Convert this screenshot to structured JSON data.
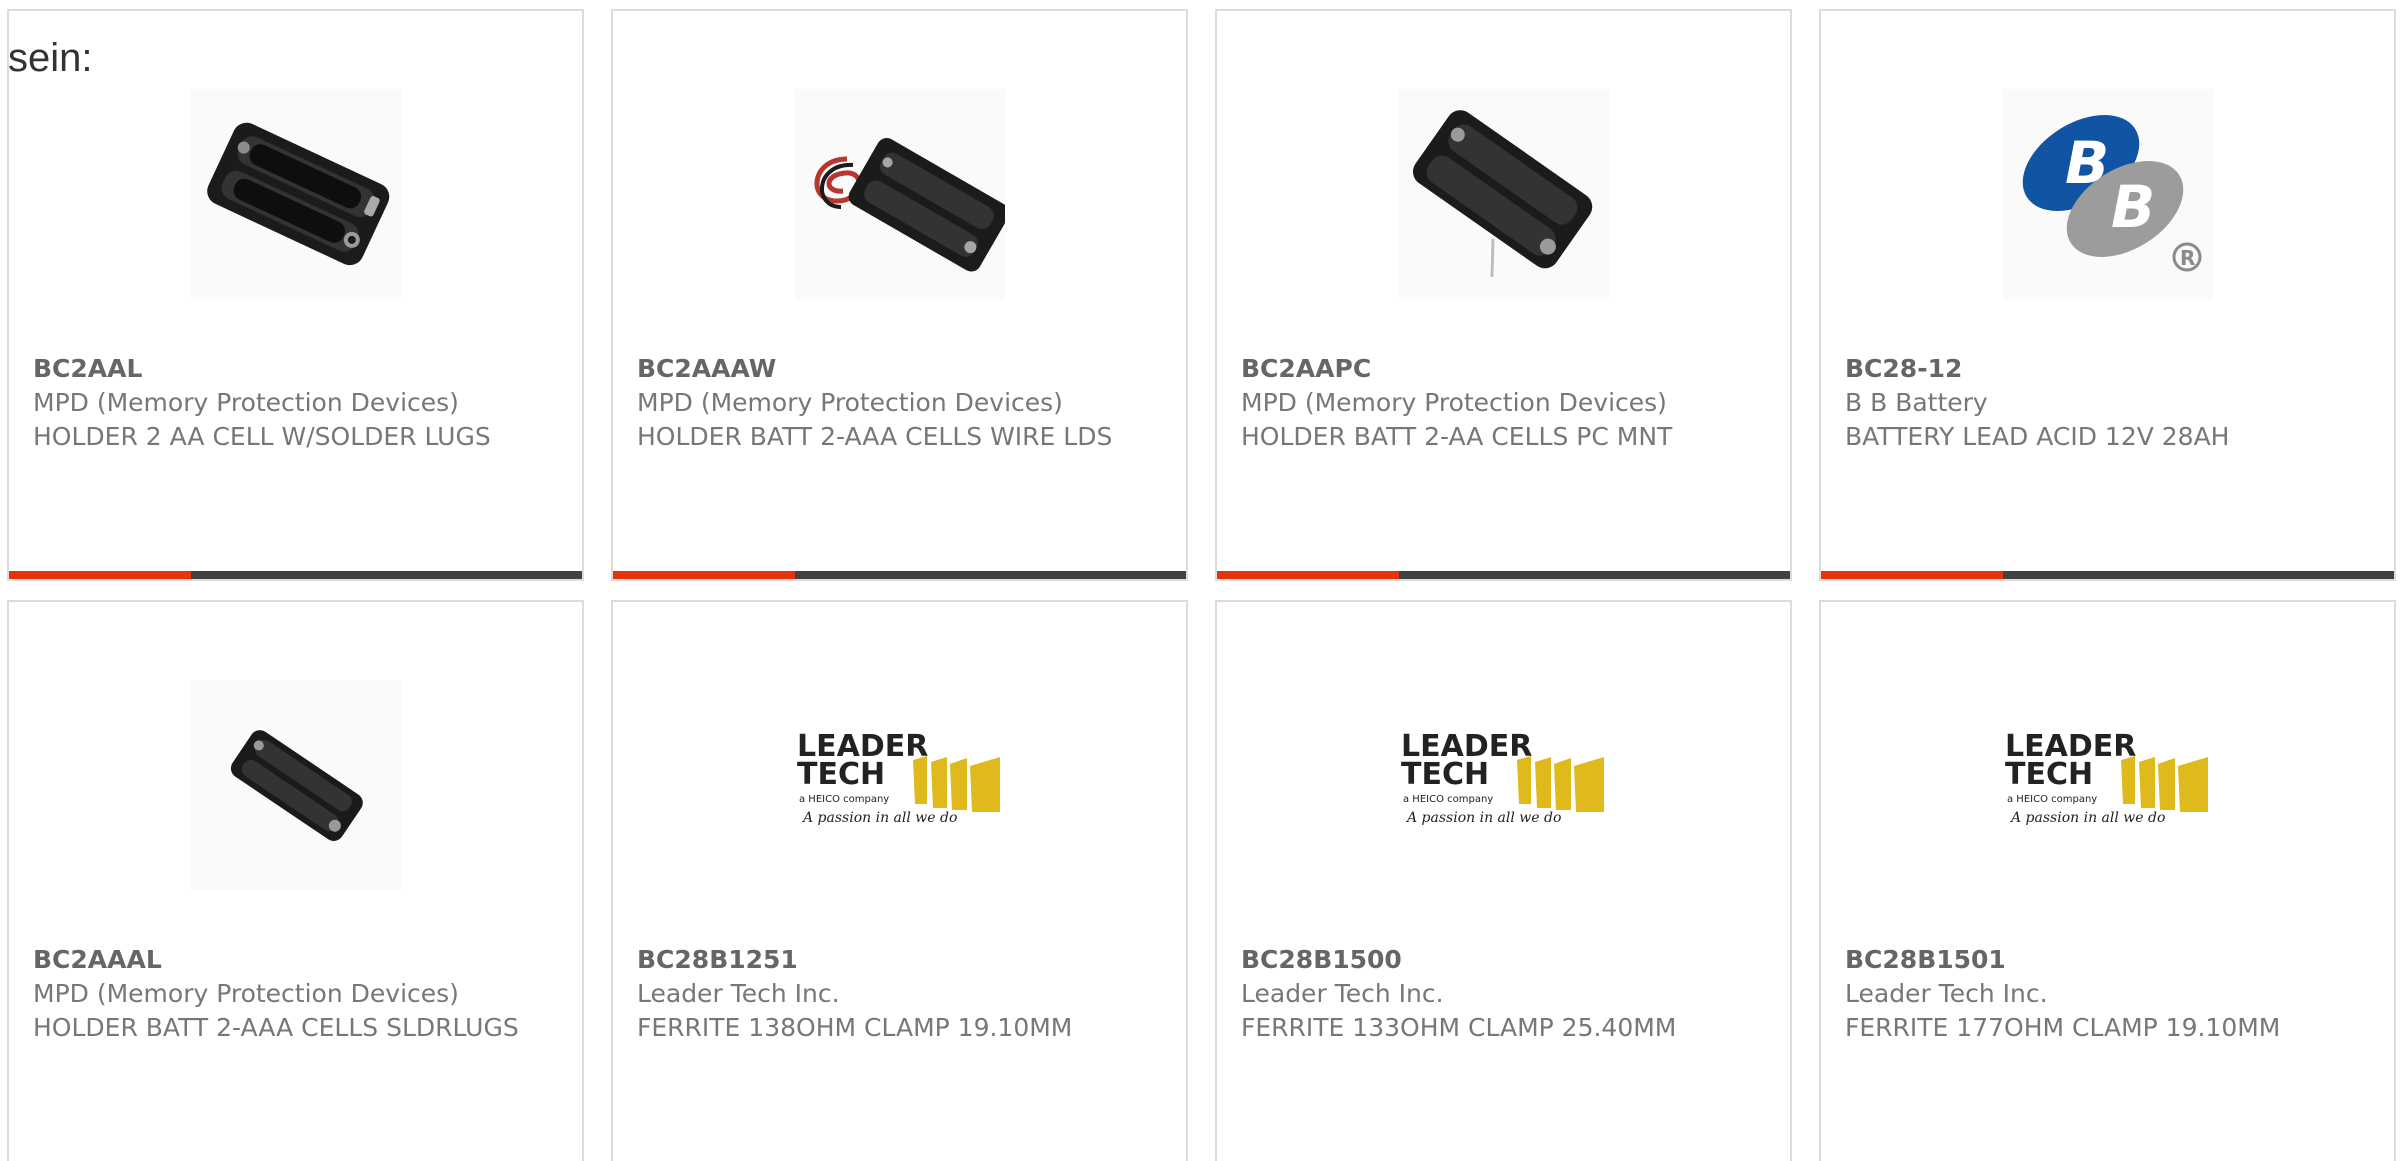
{
  "page": {
    "lead_text": "sein:"
  },
  "colors": {
    "accent": "#e4340d",
    "bar_dark": "#424242",
    "card_border": "#dcdcdc",
    "text_gray": "#777777"
  },
  "products": [
    {
      "part_number": "BC2AAL",
      "manufacturer": "MPD (Memory Protection Devices)",
      "description": "HOLDER 2 AA CELL W/SOLDER LUGS",
      "image_icon": "battery-holder-2aa-icon"
    },
    {
      "part_number": "BC2AAAW",
      "manufacturer": "MPD (Memory Protection Devices)",
      "description": "HOLDER BATT 2-AAA CELLS WIRE LDS",
      "image_icon": "battery-holder-wire-leads-icon"
    },
    {
      "part_number": "BC2AAPC",
      "manufacturer": "MPD (Memory Protection Devices)",
      "description": "HOLDER BATT 2-AA CELLS PC MNT",
      "image_icon": "battery-holder-pc-mount-icon"
    },
    {
      "part_number": "BC28-12",
      "manufacturer": "B B Battery",
      "description": "BATTERY LEAD ACID 12V 28AH",
      "image_icon": "bb-battery-logo",
      "logo_text": "B B ®"
    },
    {
      "part_number": "BC2AAAL",
      "manufacturer": "MPD (Memory Protection Devices)",
      "description": "HOLDER BATT 2-AAA CELLS SLDRLUGS",
      "image_icon": "battery-holder-2aaa-icon"
    },
    {
      "part_number": "BC28B1251",
      "manufacturer": "Leader Tech Inc.",
      "description": "FERRITE 138OHM CLAMP 19.10MM",
      "image_icon": "leader-tech-logo",
      "logo_text": "LEADER TECH a HEICO company A passion in all we do"
    },
    {
      "part_number": "BC28B1500",
      "manufacturer": "Leader Tech Inc.",
      "description": "FERRITE 133OHM CLAMP 25.40MM",
      "image_icon": "leader-tech-logo",
      "logo_text": "LEADER TECH a HEICO company A passion in all we do"
    },
    {
      "part_number": "BC28B1501",
      "manufacturer": "Leader Tech Inc.",
      "description": "FERRITE 177OHM CLAMP 19.10MM",
      "image_icon": "leader-tech-logo",
      "logo_text": "LEADER TECH a HEICO company A passion in all we do"
    }
  ]
}
